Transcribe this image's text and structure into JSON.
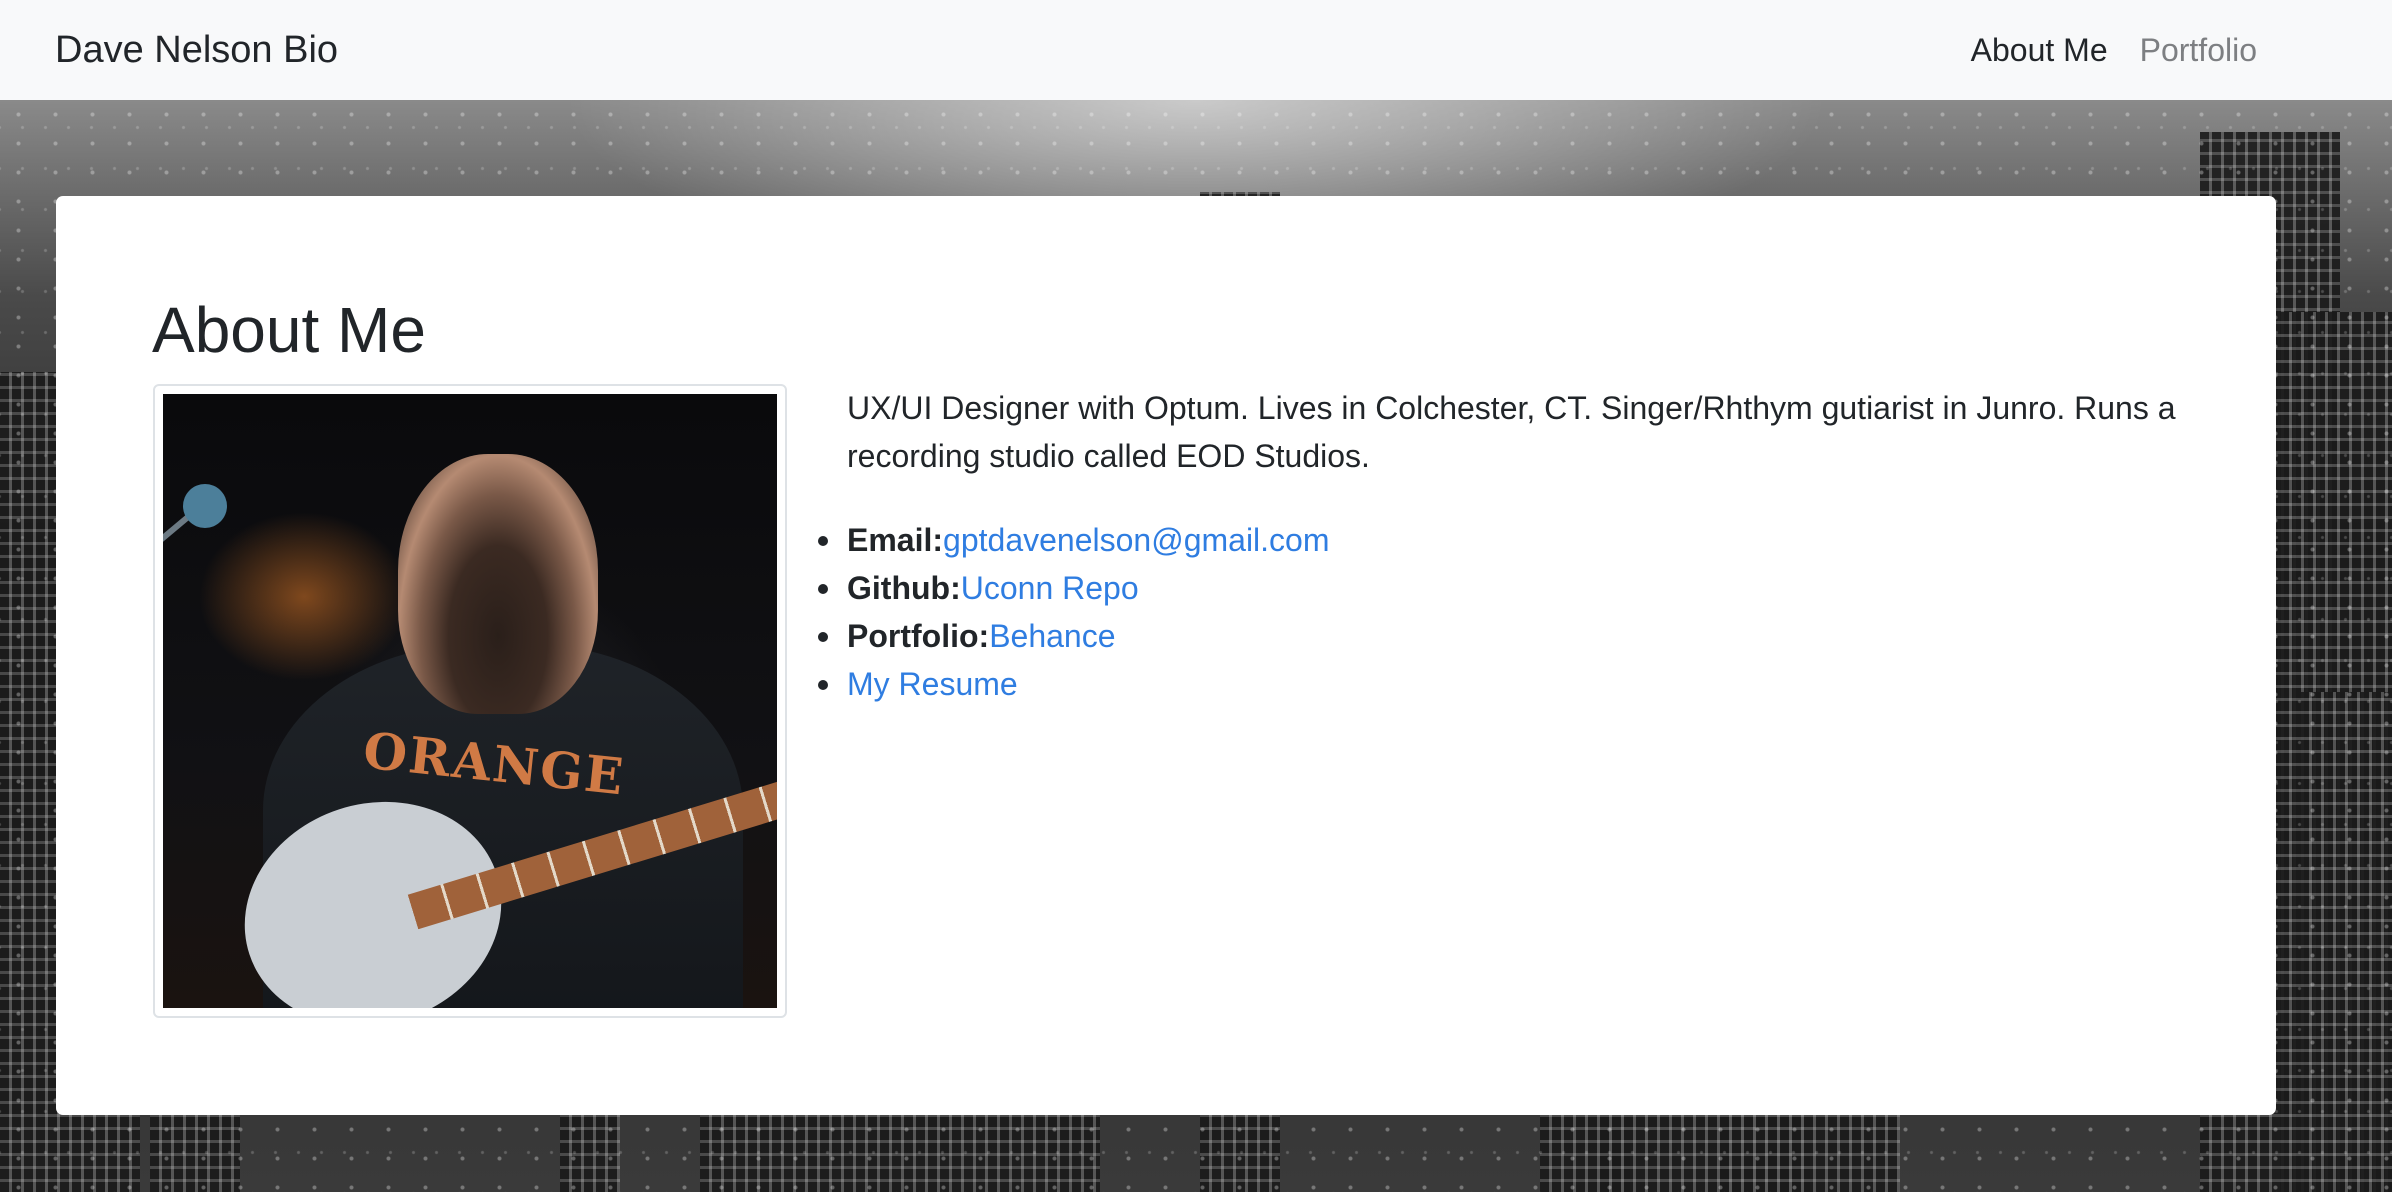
{
  "navbar": {
    "brand": "Dave Nelson Bio",
    "links": [
      {
        "label": "About Me",
        "active": true
      },
      {
        "label": "Portfolio",
        "active": false
      }
    ]
  },
  "card": {
    "heading": "About Me",
    "photo_icon": "profile-photo-guitarist",
    "bio": "UX/UI Designer with Optum. Lives in Colchester, CT. Singer/Rhthym gutiarist in Junro. Runs a recording studio called EOD Studios.",
    "contacts": [
      {
        "label": "Email:",
        "link_text": "gptdavenelson@gmail.com"
      },
      {
        "label": "Github:",
        "link_text": "Uconn Repo"
      },
      {
        "label": "Portfolio:",
        "link_text": "Behance"
      },
      {
        "label": "",
        "link_text": "My Resume"
      }
    ]
  },
  "colors": {
    "navbar_bg": "#f8f9fa",
    "link": "#2f7de1",
    "text": "#212529",
    "muted_nav": "#7d7f82"
  }
}
